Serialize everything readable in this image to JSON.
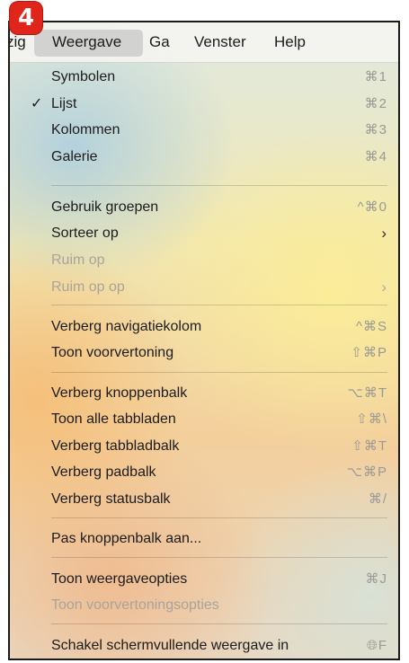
{
  "badge": {
    "number": "4"
  },
  "menubar": {
    "items": [
      "zig",
      "Weergave",
      "Ga",
      "Venster",
      "Help"
    ],
    "active_index": 1
  },
  "menu": {
    "rows": [
      {
        "label": "Symbolen",
        "shortcut": "⌘1"
      },
      {
        "label": "Lijst",
        "shortcut": "⌘2",
        "check": "✓"
      },
      {
        "label": "Kolommen",
        "shortcut": "⌘3"
      },
      {
        "label": "Galerie",
        "shortcut": "⌘4"
      },
      {
        "label": "Gebruik groepen",
        "shortcut": "^⌘0"
      },
      {
        "label": "Sorteer op",
        "arrow": "›"
      },
      {
        "label": "Ruim op"
      },
      {
        "label": "Ruim op op",
        "arrow": "›"
      },
      {
        "label": "Verberg navigatiekolom",
        "shortcut": "^⌘S"
      },
      {
        "label": "Toon voorvertoning",
        "shortcut": "⇧⌘P"
      },
      {
        "label": "Verberg knoppenbalk",
        "shortcut": "⌥⌘T"
      },
      {
        "label": "Toon alle tabbladen",
        "shortcut": "⇧⌘\\"
      },
      {
        "label": "Verberg tabbladbalk",
        "shortcut": "⇧⌘T"
      },
      {
        "label": "Verberg padbalk",
        "shortcut": "⌥⌘P"
      },
      {
        "label": "Verberg statusbalk",
        "shortcut": "⌘/"
      },
      {
        "label": "Pas knoppenbalk aan..."
      },
      {
        "label": "Toon weergaveopties",
        "shortcut": "⌘J"
      },
      {
        "label": "Toon voorvertoningsopties"
      },
      {
        "label": "Schakel schermvullende weergave in",
        "shortcut": "🌐︎F"
      }
    ]
  }
}
